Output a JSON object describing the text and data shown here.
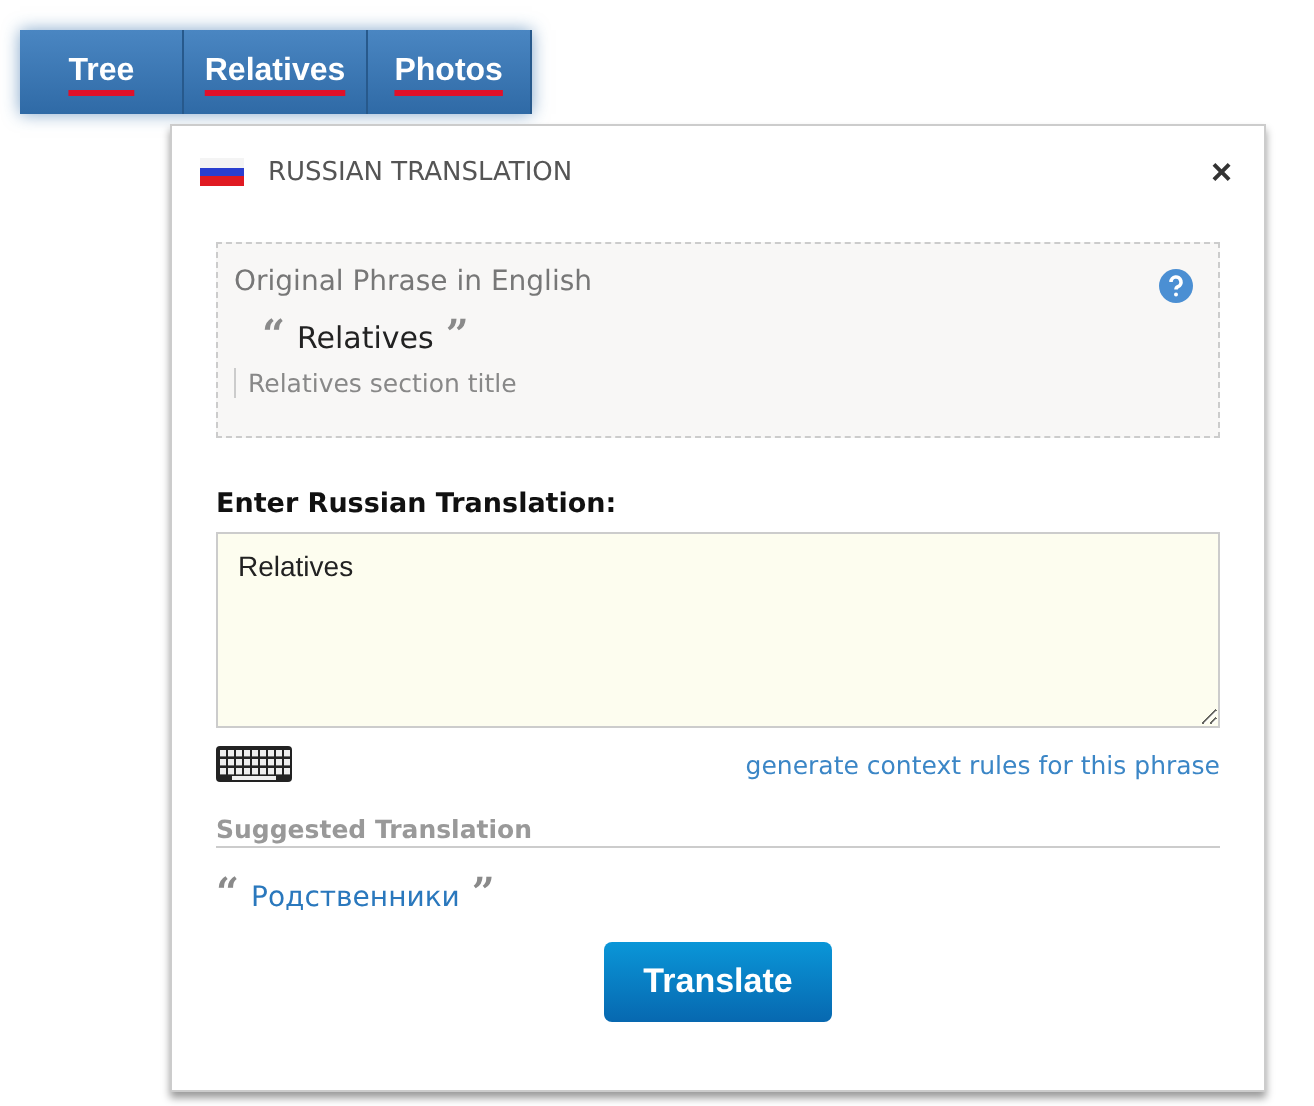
{
  "nav": {
    "tabs": [
      {
        "label": "Tree"
      },
      {
        "label": "Relatives"
      },
      {
        "label": "Photos"
      }
    ]
  },
  "dialog": {
    "title": "RUSSIAN TRANSLATION",
    "close": "×",
    "original": {
      "heading": "Original Phrase in English",
      "open_quote": "“",
      "phrase": "Relatives",
      "close_quote": "”",
      "note": "Relatives section title"
    },
    "entry": {
      "label": "Enter Russian Translation:",
      "value": "Relatives",
      "link": "generate context rules for this phrase"
    },
    "suggested": {
      "heading": "Suggested Translation",
      "open_quote": "“",
      "text": "Родственники",
      "close_quote": "”"
    },
    "button": "Translate"
  }
}
